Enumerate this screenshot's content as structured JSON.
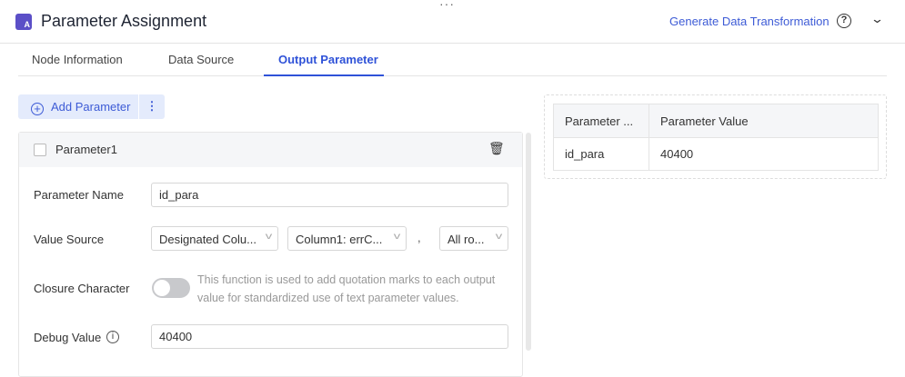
{
  "header": {
    "more": "···",
    "title": "Parameter Assignment",
    "logo_text": "A",
    "generate_link": "Generate Data Transformation",
    "help_icon": "?",
    "collapse_icon": "⌄"
  },
  "tabs": [
    {
      "label": "Node Information"
    },
    {
      "label": "Data Source"
    },
    {
      "label": "Output Parameter"
    }
  ],
  "toolbar": {
    "add_label": "Add Parameter",
    "more_label": "⋮"
  },
  "parameter": {
    "title": "Parameter1",
    "name_label": "Parameter Name",
    "name_value": "id_para",
    "source_label": "Value Source",
    "source_type": "Designated Colu...",
    "source_column": "Column1: errC...",
    "separator": ",",
    "source_rows": "All ro...",
    "closure_label": "Closure Character",
    "closure_enabled": false,
    "closure_hint": "This function is used to add quotation marks to each output value for standardized use of text parameter values.",
    "debug_label": "Debug Value",
    "debug_value": "40400"
  },
  "preview": {
    "headers": [
      "Parameter ...",
      "Parameter Value"
    ],
    "rows": [
      [
        "id_para",
        "40400"
      ]
    ]
  }
}
